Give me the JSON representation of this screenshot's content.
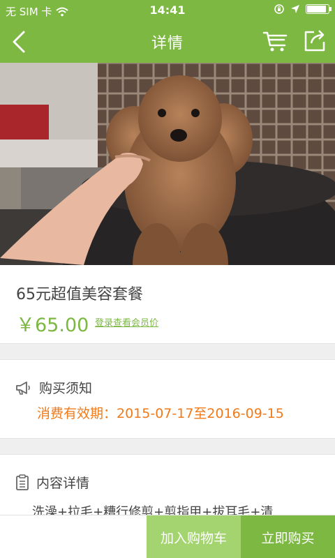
{
  "status_bar": {
    "carrier": "无 SIM 卡",
    "time": "14:41",
    "battery_level": 0.92
  },
  "nav": {
    "title": "详情"
  },
  "product": {
    "name": "65元超值美容套餐",
    "price": "￥65.00",
    "member_price_link": "登录查看会员价"
  },
  "purchase_notice": {
    "title": "购买须知",
    "validity": "消费有效期：2015-07-17至2016-09-15"
  },
  "content_details": {
    "title": "内容详情",
    "text": "洗澡+拉毛+糟行修剪+剪指甲+拔耳毛+清"
  },
  "actions": {
    "add_to_cart": "加入购物车",
    "buy_now": "立即购买"
  },
  "colors": {
    "brand_green": "#7db843",
    "light_green": "#a4d46f",
    "orange": "#f07a1a"
  }
}
